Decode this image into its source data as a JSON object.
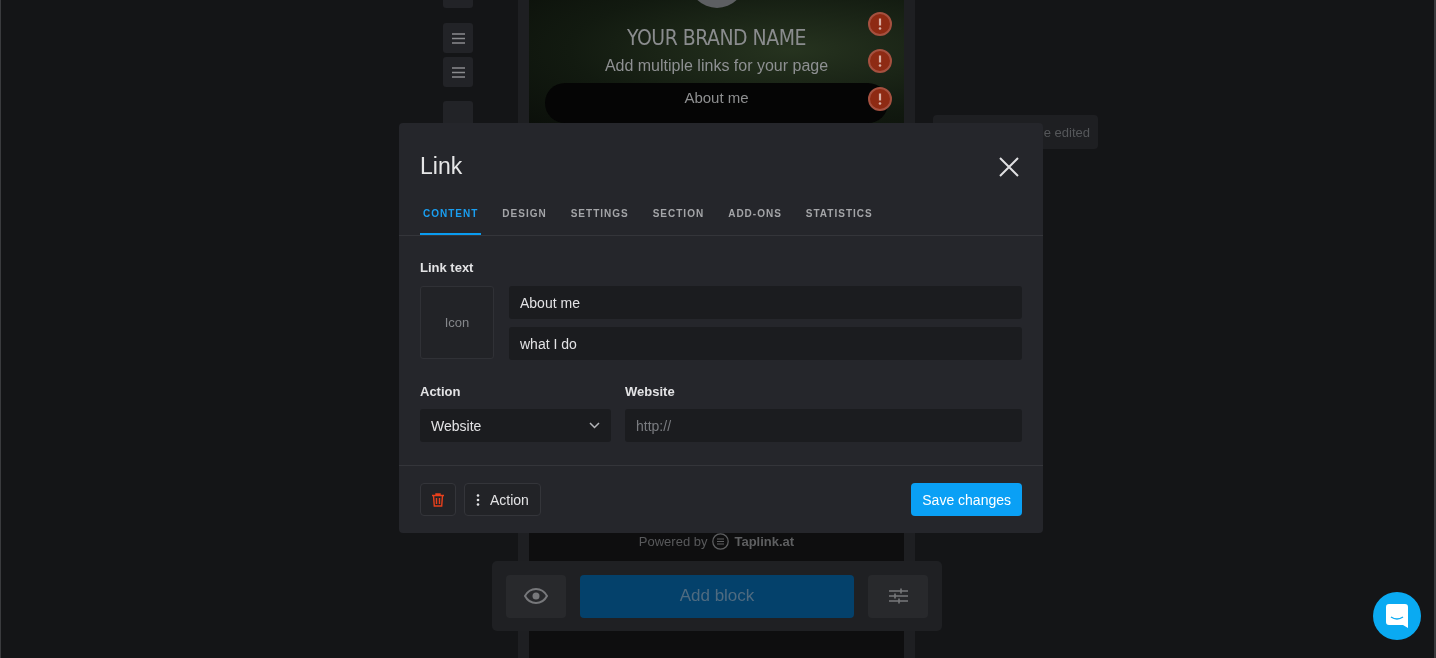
{
  "background": {
    "brand_name": "YOUR BRAND NAME",
    "subtitle": "Add multiple links for your page",
    "link_button": "About me",
    "powered_by": "Powered by",
    "powered_brand": "Taplink.at",
    "tooltip": "e edited",
    "add_block": "Add block"
  },
  "modal": {
    "title": "Link",
    "tabs": [
      {
        "label": "CONTENT",
        "selected": true
      },
      {
        "label": "DESIGN",
        "selected": false
      },
      {
        "label": "SETTINGS",
        "selected": false
      },
      {
        "label": "SECTION",
        "selected": false
      },
      {
        "label": "ADD-ONS",
        "selected": false
      },
      {
        "label": "STATISTICS",
        "selected": false
      }
    ],
    "link_text_label": "Link text",
    "icon_label": "Icon",
    "title_value": "About me",
    "subtitle_value": "what I do",
    "action_label": "Action",
    "action_value": "Website",
    "website_label": "Website",
    "website_placeholder": "http://",
    "action_button": "Action",
    "save_button": "Save changes"
  }
}
